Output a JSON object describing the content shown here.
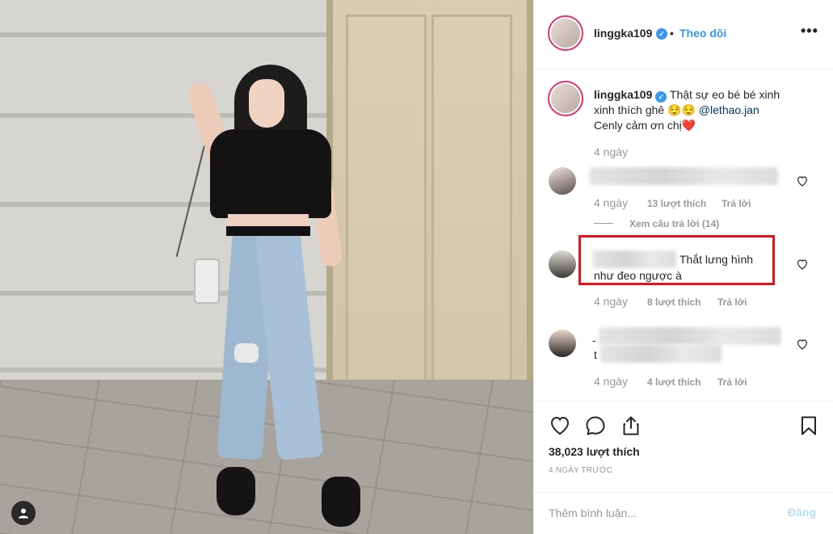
{
  "post": {
    "username": "linggka109",
    "follow_label": "Theo dõi",
    "separator": "•",
    "more_label": "•••"
  },
  "caption": {
    "username": "linggka109",
    "line1": "Thật sự eo bé bé xinh",
    "line2_prefix": "xinh thích ghê",
    "emoji": "😌😌",
    "mention": "@lethao.jan",
    "line3": "Cenly cảm ơn chị",
    "heart_emoji": "❤️",
    "age": "4 ngày"
  },
  "comments": [
    {
      "age": "4 ngày",
      "likes": "13 lượt thích",
      "reply_label": "Trả lời",
      "view_replies": "Xem câu trả lời (14)"
    },
    {
      "text_line1": "Thắt lưng hình",
      "text_line2": "như đeo ngược à",
      "age": "4 ngày",
      "likes": "8 lượt thích",
      "reply_label": "Trả lời"
    },
    {
      "lead_char_1": "-",
      "lead_char_2": "t",
      "age": "4 ngày",
      "likes": "4 lượt thích",
      "reply_label": "Trả lời"
    }
  ],
  "actions": {
    "likes_count": "38,023 lượt thích",
    "posted_ago": "4 NGÀY TRƯỚC"
  },
  "add_comment": {
    "placeholder": "Thêm bình luận...",
    "post_label": "Đăng"
  },
  "colors": {
    "link_blue": "#3897f0",
    "highlight_red": "#e4131b",
    "muted": "#999999",
    "post_disabled": "#b2dffc"
  },
  "icons": {
    "verified": "verified-badge-icon",
    "like": "heart-icon",
    "comment": "comment-bubble-icon",
    "share": "share-icon",
    "save": "bookmark-icon",
    "user_tag": "user-tag-icon"
  }
}
